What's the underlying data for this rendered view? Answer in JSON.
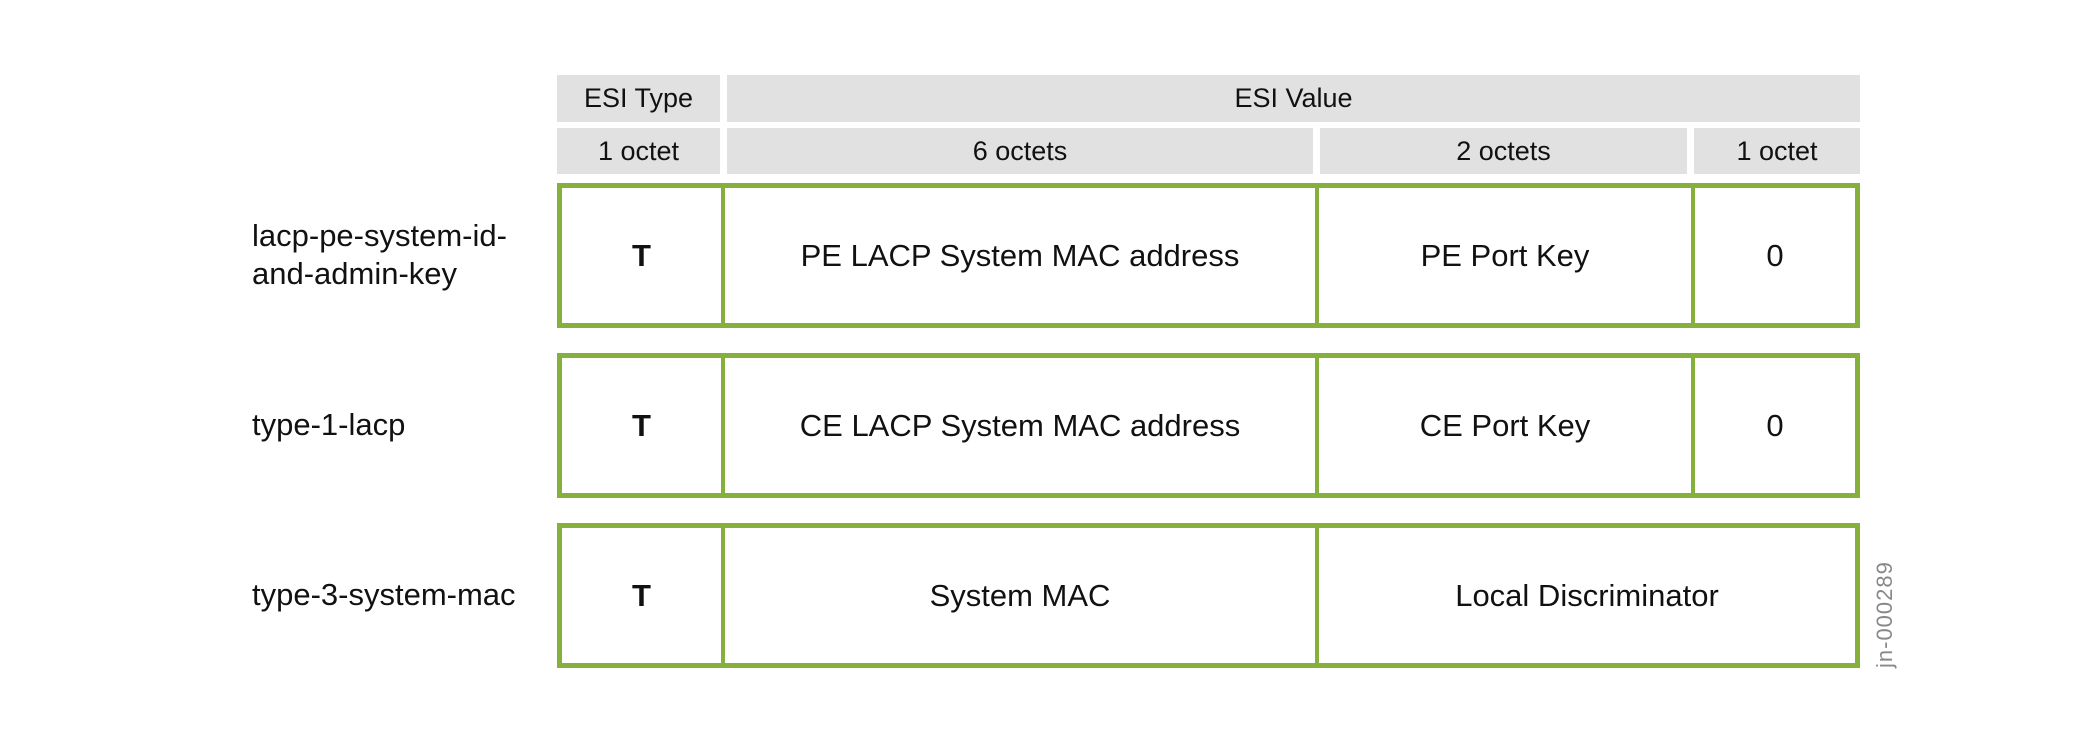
{
  "header": {
    "row1": [
      "ESI Type",
      "ESI Value"
    ],
    "row2": [
      "1 octet",
      "6 octets",
      "2 octets",
      "1 octet"
    ]
  },
  "rows": [
    {
      "label": "lacp-pe-system-id-and-admin-key",
      "label_lines": [
        "lacp-pe-system-id-",
        "and-admin-key"
      ],
      "cells": [
        "T",
        "PE LACP System MAC address",
        "PE Port Key",
        "0"
      ]
    },
    {
      "label": "type-1-lacp",
      "cells": [
        "T",
        "CE LACP System MAC address",
        "CE Port Key",
        "0"
      ]
    },
    {
      "label": "type-3-system-mac",
      "cells": [
        "T",
        "System MAC",
        "Local Discriminator"
      ]
    }
  ],
  "figure_id": "jn-000289",
  "colors": {
    "border": "#86b03c",
    "header_bg": "#e1e1e1"
  }
}
